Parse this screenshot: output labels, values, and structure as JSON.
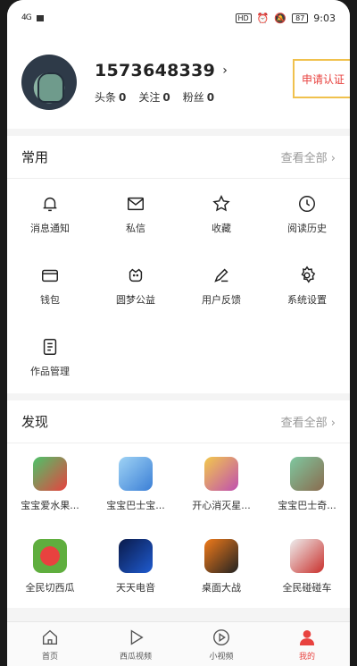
{
  "status": {
    "signal": "4G",
    "time": "9:03",
    "hd": "HD",
    "battery": "87"
  },
  "profile": {
    "username": "1573648339",
    "chevron": "›",
    "stats": [
      {
        "label": "头条",
        "value": "0"
      },
      {
        "label": "关注",
        "value": "0"
      },
      {
        "label": "粉丝",
        "value": "0"
      }
    ],
    "verify_label": "申请认证"
  },
  "common": {
    "title": "常用",
    "see_all": "查看全部 ›",
    "items": [
      {
        "label": "消息通知",
        "icon": "bell-icon"
      },
      {
        "label": "私信",
        "icon": "mail-icon"
      },
      {
        "label": "收藏",
        "icon": "star-icon"
      },
      {
        "label": "阅读历史",
        "icon": "clock-icon"
      },
      {
        "label": "钱包",
        "icon": "wallet-icon"
      },
      {
        "label": "圆梦公益",
        "icon": "charity-icon"
      },
      {
        "label": "用户反馈",
        "icon": "feedback-icon"
      },
      {
        "label": "系统设置",
        "icon": "gear-icon"
      },
      {
        "label": "作品管理",
        "icon": "document-icon"
      }
    ]
  },
  "discover": {
    "title": "发现",
    "see_all": "查看全部 ›",
    "items": [
      {
        "label": "宝宝爱水果...",
        "color": "#e8423f"
      },
      {
        "label": "宝宝巴士宝...",
        "color": "#3b7fd6"
      },
      {
        "label": "开心消灭星...",
        "color": "#c04fb0"
      },
      {
        "label": "宝宝巴士奇...",
        "color": "#8a6b4e"
      },
      {
        "label": "全民切西瓜",
        "color": "#5fae3e"
      },
      {
        "label": "天天电音",
        "color": "#1f5bd0"
      },
      {
        "label": "桌面大战",
        "color": "#f07a1a"
      },
      {
        "label": "全民碰碰车",
        "color": "#d8d8d8"
      }
    ]
  },
  "tabs": [
    {
      "label": "首页",
      "icon": "home-icon"
    },
    {
      "label": "西瓜视频",
      "icon": "play-icon"
    },
    {
      "label": "小视频",
      "icon": "video-icon"
    },
    {
      "label": "我的",
      "icon": "user-icon",
      "active": true
    }
  ]
}
